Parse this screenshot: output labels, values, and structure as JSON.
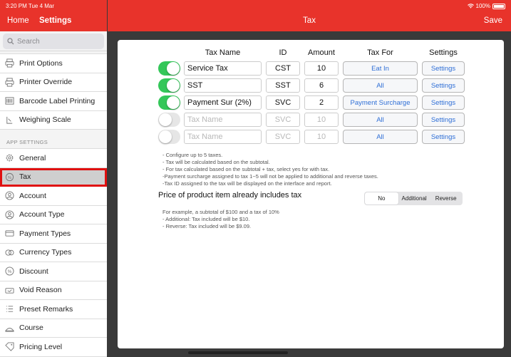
{
  "status_bar": {
    "time_date": "3:20 PM  Tue 4 Mar",
    "battery": "100%"
  },
  "sidebar": {
    "home_label": "Home",
    "settings_label": "Settings",
    "search_placeholder": "Search",
    "items_top": [
      {
        "label": "Print Options",
        "icon": "printer-icon"
      },
      {
        "label": "Printer Override",
        "icon": "printer-icon"
      },
      {
        "label": "Barcode Label Printing",
        "icon": "barcode-icon"
      },
      {
        "label": "Weighing Scale",
        "icon": "scale-icon"
      }
    ],
    "section_label": "APP SETTINGS",
    "items_app": [
      {
        "label": "General",
        "icon": "gear-icon"
      },
      {
        "label": "Tax",
        "icon": "tax-icon",
        "active": true
      },
      {
        "label": "Account",
        "icon": "user-icon"
      },
      {
        "label": "Account Type",
        "icon": "user-icon"
      },
      {
        "label": "Payment Types",
        "icon": "card-icon"
      },
      {
        "label": "Currency Types",
        "icon": "currency-icon"
      },
      {
        "label": "Discount",
        "icon": "percent-icon"
      },
      {
        "label": "Void Reason",
        "icon": "ticket-icon"
      },
      {
        "label": "Preset Remarks",
        "icon": "list-icon"
      },
      {
        "label": "Course",
        "icon": "course-icon"
      },
      {
        "label": "Pricing Level",
        "icon": "tag-icon"
      }
    ]
  },
  "header": {
    "title": "Tax",
    "save_label": "Save"
  },
  "table": {
    "headers": {
      "name": "Tax Name",
      "id": "ID",
      "amount": "Amount",
      "tax_for": "Tax For",
      "settings": "Settings"
    },
    "rows": [
      {
        "enabled": true,
        "name": "Service Tax",
        "id": "CST",
        "amount": "10",
        "tax_for": "Eat In",
        "settings": "Settings",
        "placeholder": false
      },
      {
        "enabled": true,
        "name": "SST",
        "id": "SST",
        "amount": "6",
        "tax_for": "All",
        "settings": "Settings",
        "placeholder": false
      },
      {
        "enabled": true,
        "name": "Payment Sur (2%)",
        "id": "SVC",
        "amount": "2",
        "tax_for": "Payment Surcharge",
        "settings": "Settings",
        "placeholder": false
      },
      {
        "enabled": false,
        "name": "Tax Name",
        "id": "SVC",
        "amount": "10",
        "tax_for": "All",
        "settings": "Settings",
        "placeholder": true
      },
      {
        "enabled": false,
        "name": "Tax Name",
        "id": "SVC",
        "amount": "10",
        "tax_for": "All",
        "settings": "Settings",
        "placeholder": true
      }
    ]
  },
  "notes": [
    "- Configure up to 5 taxes.",
    "- Tax will be calculated based on the subtotal.",
    "- For tax calculated based on the subtotal + tax, select yes for with tax.",
    "-Payment surcharge assigned to tax 1~5 will not be applied to additional and reverse taxes.",
    "-Tax ID assigned to the tax will be displayed on the interface and report."
  ],
  "price_includes": {
    "title": "Price of product item already includes tax",
    "options": [
      "No",
      "Additional",
      "Reverse"
    ],
    "selected": "No",
    "example": [
      "For example, a subtotal of $100 and a tax of 10%",
      "- Additional: Tax included will be $10.",
      "- Reverse: Tax included will be $9.09."
    ]
  },
  "colors": {
    "brand_red": "#e8332b",
    "toggle_on": "#34c759",
    "link_blue": "#2f6fd6",
    "highlight_outline": "#e01010"
  }
}
